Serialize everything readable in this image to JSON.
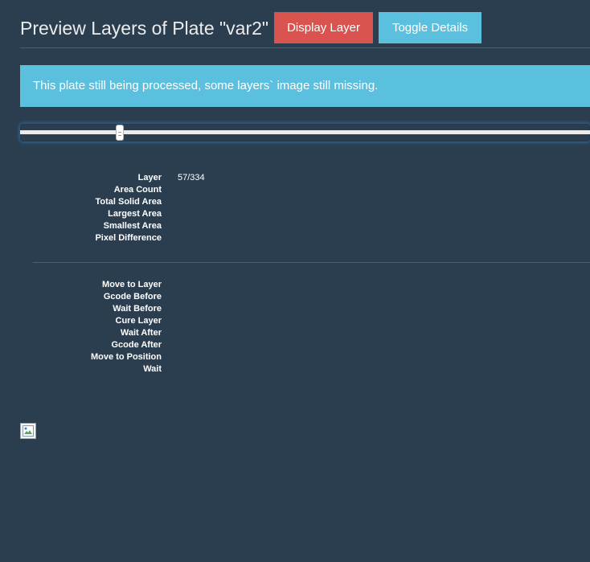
{
  "header": {
    "title": "Preview Layers of Plate \"var2\"",
    "display_layer_label": "Display Layer",
    "toggle_details_label": "Toggle Details"
  },
  "colors": {
    "background": "#2b3e50",
    "danger": "#d9534f",
    "info": "#5bc0de"
  },
  "alert": {
    "message": "This plate still being processed, some layers` image still missing."
  },
  "slider": {
    "current_layer": 57,
    "total_layers": 334
  },
  "layer_info": [
    {
      "label": "Layer",
      "value": "57/334"
    },
    {
      "label": "Area Count",
      "value": ""
    },
    {
      "label": "Total Solid Area",
      "value": ""
    },
    {
      "label": "Largest Area",
      "value": ""
    },
    {
      "label": "Smallest Area",
      "value": ""
    },
    {
      "label": "Pixel Difference",
      "value": ""
    }
  ],
  "layer_steps": [
    {
      "label": "Move to Layer",
      "value": ""
    },
    {
      "label": "Gcode Before",
      "value": ""
    },
    {
      "label": "Wait Before",
      "value": ""
    },
    {
      "label": "Cure Layer",
      "value": ""
    },
    {
      "label": "Wait After",
      "value": ""
    },
    {
      "label": "Gcode After",
      "value": ""
    },
    {
      "label": "Move to Position",
      "value": ""
    },
    {
      "label": "Wait",
      "value": ""
    }
  ],
  "preview_image": {
    "icon": "broken-image-icon"
  }
}
